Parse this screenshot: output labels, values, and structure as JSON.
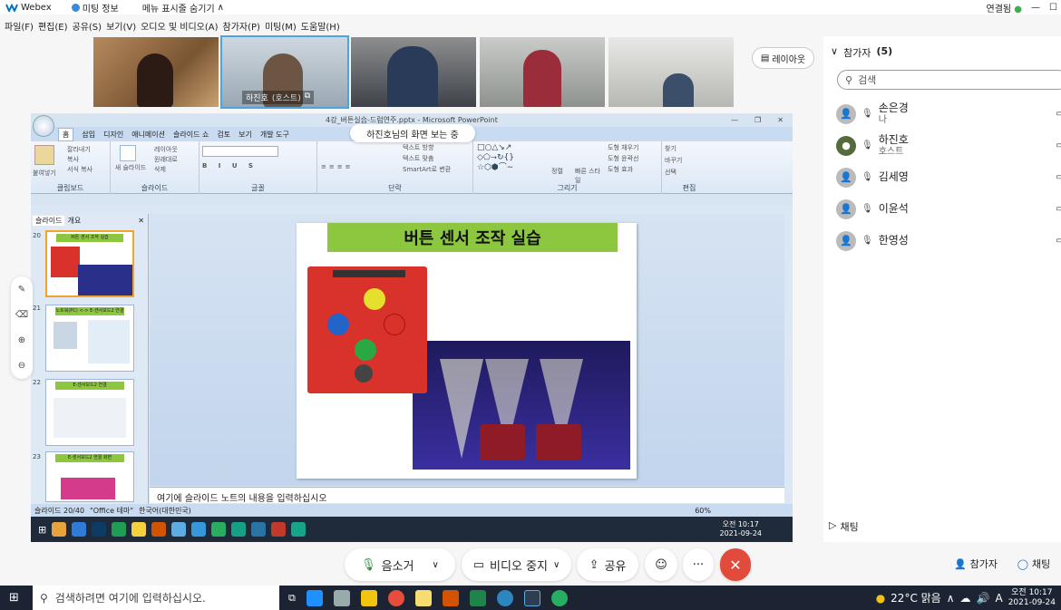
{
  "app": {
    "name": "Webex",
    "meeting_info": "미팅 정보",
    "hide_menu": "메뉴 표시줄 숨기기",
    "status": "연결됨"
  },
  "menu": [
    "파일(F)",
    "편집(E)",
    "공유(S)",
    "보기(V)",
    "오디오 및 비디오(A)",
    "참가자(P)",
    "미팅(M)",
    "도움말(H)"
  ],
  "video_thumbs": {
    "host_label": "하진호",
    "host_tag": "(호스트)"
  },
  "layout_button": "레이아웃",
  "share": {
    "banner": "하진호님의 화면 보는 중",
    "ppt_title": "4강_버튼실습-드럼연주.pptx - Microsoft PowerPoint",
    "ribbon_tabs": [
      "홈",
      "삽입",
      "디자인",
      "애니메이션",
      "슬라이드 쇼",
      "검토",
      "보기",
      "개발 도구"
    ],
    "groups": [
      "클립보드",
      "슬라이드",
      "글꼴",
      "단락",
      "그리기",
      "편집"
    ],
    "ribbon_items": {
      "paste": "붙여넣기",
      "cut": "잘라내기",
      "copy": "복사",
      "format": "서식 복사",
      "new_slide": "새 슬라이드",
      "layout": "레이아웃",
      "reset": "원래대로",
      "delete": "삭제",
      "find": "찾기",
      "replace": "바꾸기",
      "select": "선택",
      "arrange": "정렬",
      "quick_style": "빠른 스타일",
      "text_dir": "텍스트 방향",
      "text_align": "텍스트 맞춤",
      "smartart": "SmartArt로 변환",
      "shape_fill": "도형 채우기",
      "shape_outline": "도형 윤곽선",
      "shape_effect": "도형 효과"
    },
    "left_tabs": [
      "슬라이드",
      "개요"
    ],
    "slide_nums": [
      "20",
      "21",
      "22",
      "23"
    ],
    "thumb_titles": [
      "버튼 센서 조작 실습",
      "노트북(PC) <-> E-센서보드2 연결",
      "E-센서보드2 연결",
      "E-센서보드2 연결 화면"
    ],
    "slide_title": "버튼 센서 조작 실습",
    "notes_placeholder": "여기에 슬라이드 노트의 내용을 입력하십시오",
    "status": {
      "slide": "슬라이드 20/40",
      "theme": "\"Office 테마\"",
      "lang": "한국어(대한민국)",
      "zoom": "60%"
    },
    "inner_clock": {
      "time": "오전 10:17",
      "date": "2021-09-24"
    }
  },
  "panel": {
    "title": "참가자",
    "count": "(5)",
    "search_placeholder": "검색",
    "participants": [
      {
        "name": "손은경",
        "role": "나",
        "has_photo": false
      },
      {
        "name": "하진호",
        "role": "호스트",
        "has_photo": true
      },
      {
        "name": "김세영",
        "role": "",
        "has_photo": false
      },
      {
        "name": "이윤석",
        "role": "",
        "has_photo": false
      },
      {
        "name": "한영성",
        "role": "",
        "has_photo": false
      }
    ],
    "chat_toggle": "채팅"
  },
  "controls": {
    "mute": "음소거",
    "video": "비디오 중지",
    "share": "공유",
    "participants": "참가자",
    "chat": "채팅"
  },
  "taskbar": {
    "search": "검색하려면 여기에 입력하십시오.",
    "weather": "22°C 맑음",
    "ime": "A",
    "time": "오전 10:17",
    "date": "2021-09-24"
  },
  "colors": {
    "accent": "#4aa5e0",
    "leave": "#e24a3b",
    "slide_title_bg": "#8dc63f",
    "board": "#d9322a"
  }
}
